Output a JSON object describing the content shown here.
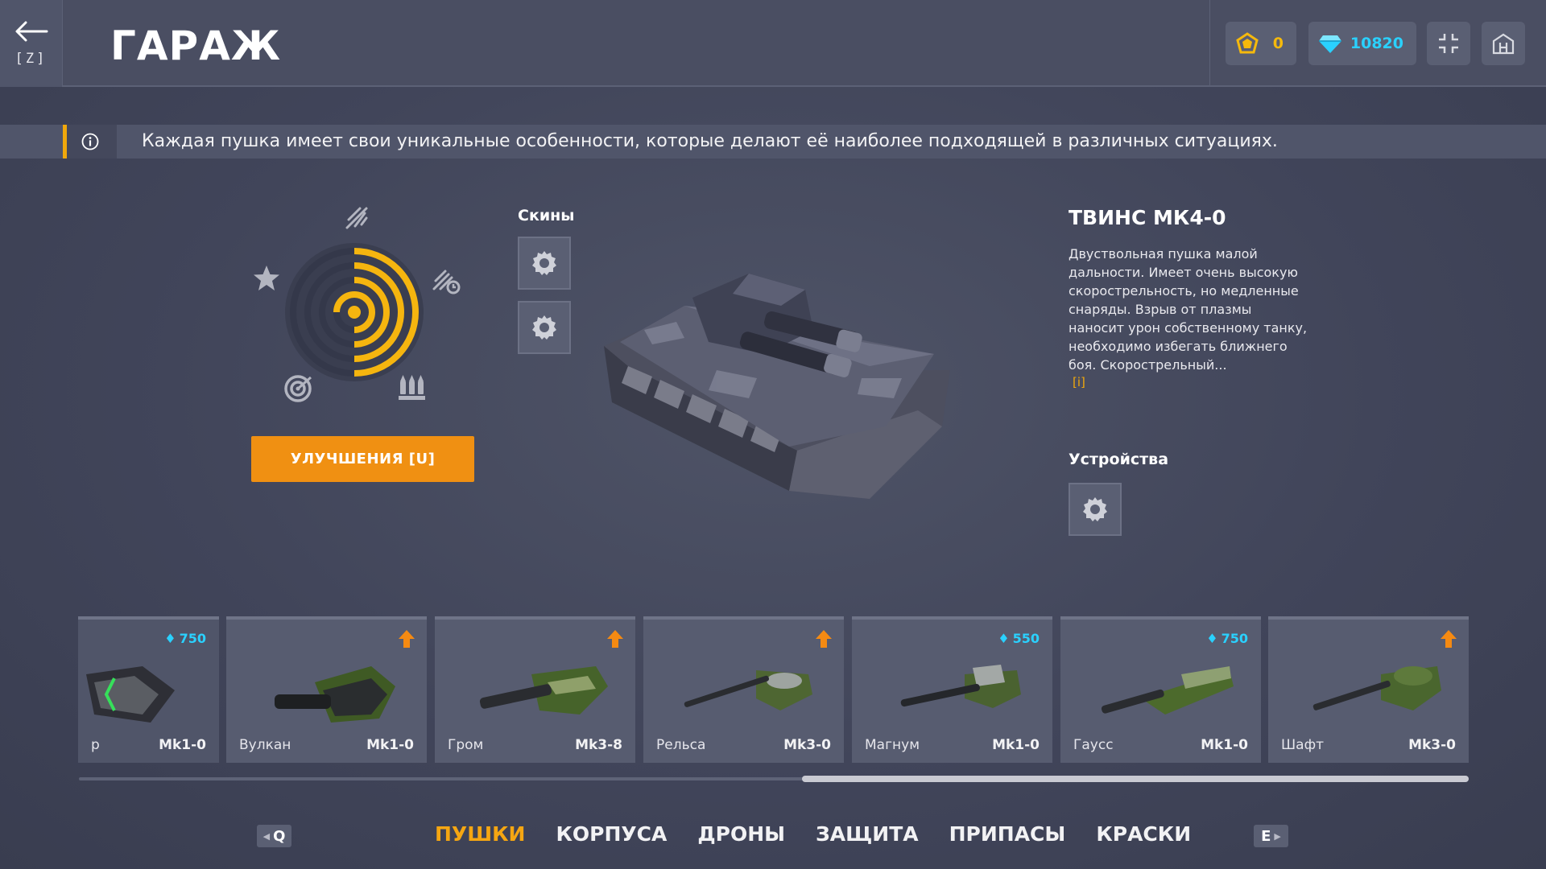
{
  "header": {
    "back_key": "[Z]",
    "title": "ГАРАЖ",
    "crystals": "0",
    "gems": "10820"
  },
  "info": {
    "text": "Каждая пушка имеет свои уникальные особенности, которые делают её наиболее подходящей в различных ситуациях."
  },
  "upgrades": {
    "label": "УЛУЧШЕНИЯ [U]"
  },
  "skins": {
    "label": "Скины"
  },
  "turret": {
    "title": "ТВИНС МК4-0",
    "description": "Двуствольная пушка малой дальности. Имеет очень высокую скорострельность, но медленные снаряды. Взрыв от плазмы наносит урон собственному танку, необходимо избегать ближнего боя. Скорострельный...",
    "more": "[i]"
  },
  "devices": {
    "label": "Устройства"
  },
  "carousel": {
    "items": [
      {
        "name": "p",
        "level": "Mk1-0",
        "price": "750",
        "badge": "price"
      },
      {
        "name": "Вулкан",
        "level": "Mk1-0",
        "price": "",
        "badge": "upgrade"
      },
      {
        "name": "Гром",
        "level": "Mk3-8",
        "price": "",
        "badge": "upgrade"
      },
      {
        "name": "Рельса",
        "level": "Mk3-0",
        "price": "",
        "badge": "upgrade"
      },
      {
        "name": "Магнум",
        "level": "Mk1-0",
        "price": "550",
        "badge": "price"
      },
      {
        "name": "Гаусс",
        "level": "Mk1-0",
        "price": "750",
        "badge": "price"
      },
      {
        "name": "Шафт",
        "level": "Mk3-0",
        "price": "",
        "badge": "upgrade"
      }
    ]
  },
  "tabs": {
    "prev_key": "Q",
    "next_key": "E",
    "items": [
      {
        "label": "ПУШКИ",
        "active": true
      },
      {
        "label": "КОРПУСА",
        "active": false
      },
      {
        "label": "ДРОНЫ",
        "active": false
      },
      {
        "label": "ЗАЩИТА",
        "active": false
      },
      {
        "label": "ПРИПАСЫ",
        "active": false
      },
      {
        "label": "КРАСКИ",
        "active": false
      }
    ]
  },
  "colors": {
    "accent": "#f09012",
    "gem": "#2ad1ff",
    "crystal": "#f5b90c",
    "active_tab": "#f5a612"
  }
}
